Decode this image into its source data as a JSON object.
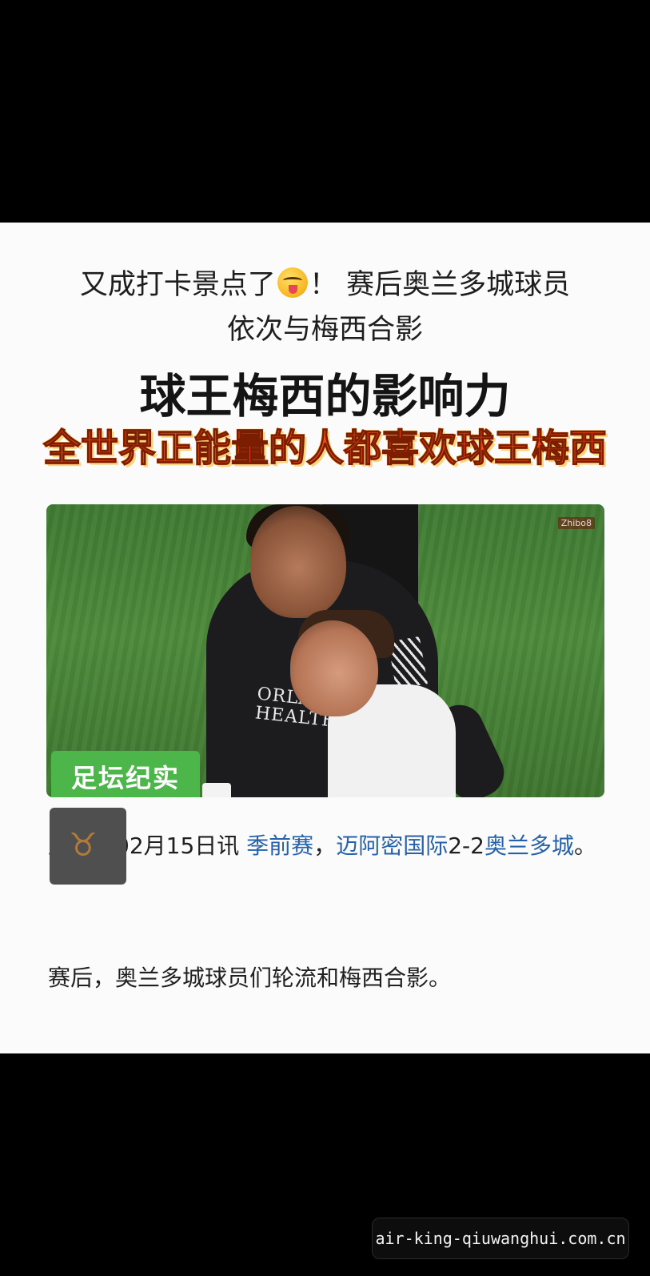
{
  "headline": {
    "line1_before_emoji": "又成打卡景点了",
    "emoji": "squinting-face-with-tongue-emoji",
    "line1_after_emoji": "！ 赛后奥兰多城球员",
    "line2": "依次与梅西合影"
  },
  "title": "球王梅西的影响力",
  "subtitle": "全世界正能量的人都喜欢球王梅西",
  "photo": {
    "watermark": "Zhibo8",
    "jersey_text_line1": "ORLANDO",
    "jersey_text_line2": "HEALTH",
    "tag": "足坛纪实"
  },
  "article": {
    "part1": "直播吧02月15日讯 ",
    "link1": "季前赛",
    "part2": "，",
    "link2": "迈阿密国际",
    "part3": "2-2",
    "link3": "奥兰多城",
    "part4": "。",
    "paragraph2": "赛后，奥兰多城球员们轮流和梅西合影。"
  },
  "footer": {
    "domain": "air-king-qiuwanghui.com.cn"
  },
  "colors": {
    "subtitle_fill": "#f04a12",
    "link": "#2661a9",
    "tag_green": "#4cb64a"
  }
}
